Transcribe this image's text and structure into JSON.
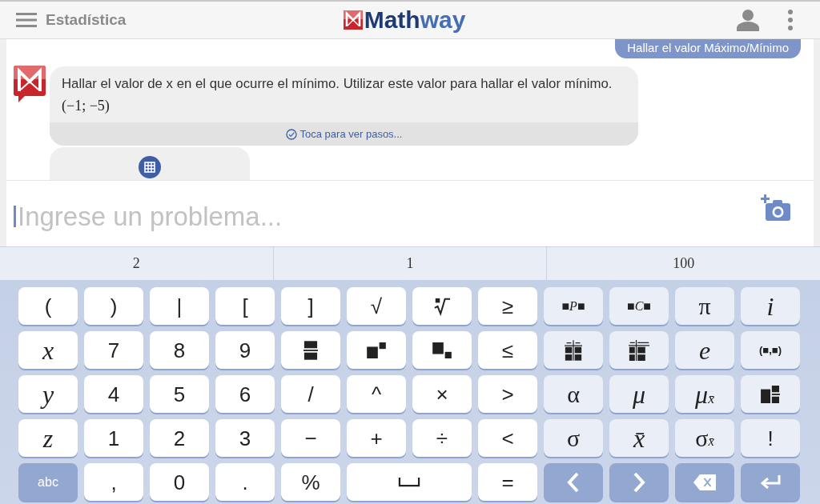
{
  "header": {
    "section": "Estadística",
    "logo": {
      "parts": [
        "Math",
        "way"
      ]
    }
  },
  "chat": {
    "query": "Hallar el valor Máximo/Mínimo",
    "answer": {
      "text": "Hallar el valor de x en el que ocurre el mínimo. Utilizar este valor para hallar el valor mínimo.",
      "result": "(−1; −5)",
      "steps_link": "Toca para ver pasos..."
    }
  },
  "input": {
    "placeholder": "Ingrese un problema..."
  },
  "suggestions": [
    "2",
    "1",
    "100"
  ],
  "keyboard": {
    "main_rows": [
      [
        {
          "kind": "text",
          "label": "("
        },
        {
          "kind": "text",
          "label": ")"
        },
        {
          "kind": "text",
          "label": "|"
        },
        {
          "kind": "text",
          "label": "["
        },
        {
          "kind": "text",
          "label": "]"
        },
        {
          "kind": "text",
          "label": "√"
        },
        {
          "kind": "radical"
        },
        {
          "kind": "text",
          "label": "≥"
        }
      ],
      [
        {
          "kind": "math",
          "label": "x"
        },
        {
          "kind": "text",
          "label": "7"
        },
        {
          "kind": "text",
          "label": "8"
        },
        {
          "kind": "text",
          "label": "9"
        },
        {
          "kind": "fraction"
        },
        {
          "kind": "power"
        },
        {
          "kind": "index"
        },
        {
          "kind": "text",
          "label": "≤"
        }
      ],
      [
        {
          "kind": "math",
          "label": "y"
        },
        {
          "kind": "text",
          "label": "4"
        },
        {
          "kind": "text",
          "label": "5"
        },
        {
          "kind": "text",
          "label": "6"
        },
        {
          "kind": "text",
          "label": "/"
        },
        {
          "kind": "text",
          "label": "^"
        },
        {
          "kind": "text",
          "label": "×"
        },
        {
          "kind": "text",
          "label": ">"
        }
      ],
      [
        {
          "kind": "math",
          "label": "z"
        },
        {
          "kind": "text",
          "label": "1"
        },
        {
          "kind": "text",
          "label": "2"
        },
        {
          "kind": "text",
          "label": "3"
        },
        {
          "kind": "text",
          "label": "−"
        },
        {
          "kind": "text",
          "label": "+"
        },
        {
          "kind": "text",
          "label": "÷"
        },
        {
          "kind": "text",
          "label": "<"
        }
      ],
      [
        {
          "kind": "mode",
          "label": "abc"
        },
        {
          "kind": "text",
          "label": ","
        },
        {
          "kind": "text",
          "label": "0"
        },
        {
          "kind": "text",
          "label": "."
        },
        {
          "kind": "text",
          "label": "%"
        },
        {
          "kind": "space"
        },
        {
          "kind": "text",
          "label": "="
        }
      ]
    ],
    "side_rows": [
      [
        {
          "kind": "compact",
          "label": "■P■"
        },
        {
          "kind": "compact",
          "label": "■C■"
        },
        {
          "kind": "greek",
          "label": "π"
        },
        {
          "kind": "math",
          "label": "i"
        }
      ],
      [
        {
          "kind": "table"
        },
        {
          "kind": "functable"
        },
        {
          "kind": "math",
          "label": "e"
        },
        {
          "kind": "pair",
          "label": "(■,■)"
        }
      ],
      [
        {
          "kind": "greek",
          "label": "α"
        },
        {
          "kind": "math",
          "label": "μ"
        },
        {
          "kind": "math",
          "label": "μ$_{x̄}$"
        },
        {
          "kind": "mixed"
        }
      ],
      [
        {
          "kind": "greek",
          "label": "σ"
        },
        {
          "kind": "math",
          "label": "x̄"
        },
        {
          "kind": "greek",
          "label": "σ$_{x̄}$"
        },
        {
          "kind": "text",
          "label": "!"
        }
      ],
      [
        {
          "kind": "left"
        },
        {
          "kind": "right"
        },
        {
          "kind": "delete"
        },
        {
          "kind": "enter"
        }
      ]
    ]
  }
}
